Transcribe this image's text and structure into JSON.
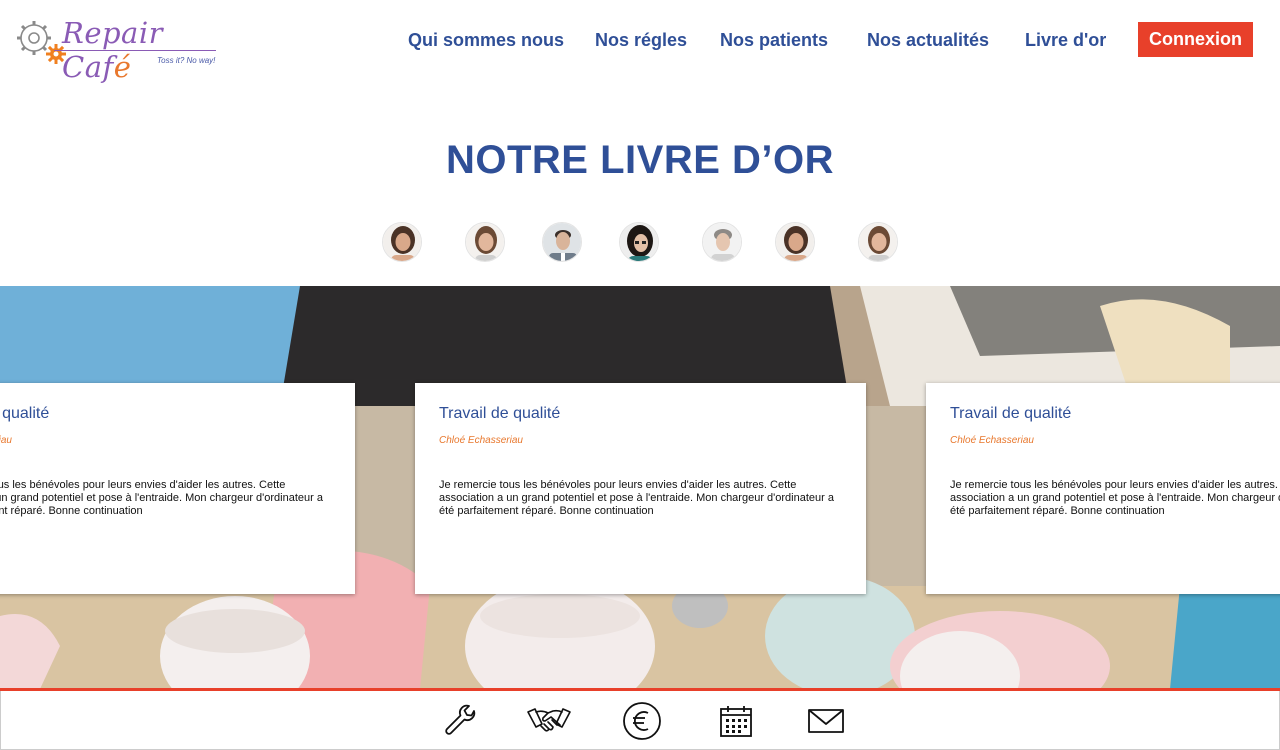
{
  "logo": {
    "text_pre": "Repair Caf",
    "text_accent": "é",
    "tagline": "Toss it? No way!"
  },
  "nav": {
    "items": [
      "Qui sommes nous",
      "Nos régles",
      "Nos patients",
      "Nos actualités",
      "Livre d'or"
    ],
    "connexion_label": "Connexion"
  },
  "page": {
    "title": "NOTRE LIVRE D’OR"
  },
  "avatars": [
    {
      "name": "woman-1",
      "skin": "#d9a88a",
      "hair": "#4a3226"
    },
    {
      "name": "woman-2",
      "skin": "#e2b79c",
      "hair": "#6b4a35"
    },
    {
      "name": "man-1",
      "skin": "#d9b49a",
      "hair": "#3a2f2a"
    },
    {
      "name": "woman-3",
      "skin": "#e3c0a7",
      "hair": "#1d1714"
    },
    {
      "name": "man-2",
      "skin": "#e5c6b0",
      "hair": "#8e8a86"
    },
    {
      "name": "woman-4",
      "skin": "#d9a88a",
      "hair": "#4a3226"
    },
    {
      "name": "woman-5",
      "skin": "#e2b79c",
      "hair": "#6b4a35"
    }
  ],
  "testimonials": [
    {
      "title": "Travail de qualité",
      "author": "Chloé Echasseriau",
      "text": "Je remercie tous les bénévoles pour leurs envies d'aider les autres. Cette association a un grand potentiel et pose à l'entraide. Mon chargeur d'ordinateur a été parfaitement réparé. Bonne continuation"
    },
    {
      "title": "Travail de qualité",
      "author": "Chloé Echasseriau",
      "text": "Je remercie tous les bénévoles pour leurs envies d'aider les autres. Cette association a un grand potentiel et pose à l'entraide. Mon chargeur d'ordinateur a été parfaitement réparé. Bonne continuation"
    },
    {
      "title": "Travail de qualité",
      "author": "Chloé Echasseriau",
      "text": "Je remercie tous les bénévoles pour leurs envies d'aider les autres. Cette association a un grand potentiel et pose à l'entraide. Mon chargeur d'ordinateur a été parfaitement réparé. Bonne continuation"
    }
  ],
  "footer_icons": [
    "wrench-icon",
    "handshake-icon",
    "euro-icon",
    "calendar-icon",
    "mail-icon"
  ],
  "colors": {
    "brand_blue": "#2f4f97",
    "accent_red": "#e8402a",
    "accent_orange": "#e8782e",
    "logo_purple": "#8a5bb5"
  }
}
